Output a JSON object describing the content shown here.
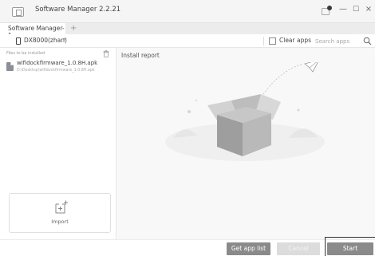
{
  "window": {
    "title": "Software Manager 2.2.21",
    "controls": {
      "minimize": "—",
      "maximize": "☐",
      "close": "×"
    }
  },
  "tabs": [
    {
      "label": "Software Manager-1"
    }
  ],
  "tab_add": "+",
  "device": {
    "name": "DX8000(zhan)",
    "caret": "▾"
  },
  "toolbar": {
    "clear_apps_label": "Clear apps",
    "clear_apps_checked": false,
    "search_placeholder": "Search apps"
  },
  "left_panel": {
    "section_label": "Files to be installed",
    "files": [
      {
        "name": "wifidockfirmware_1.0.8H.apk",
        "path": "D:\\Desktop\\wifidockfirmware_1.0.8H.apk"
      }
    ],
    "import_label": "Import"
  },
  "main_panel": {
    "title": "Install report"
  },
  "buttons": {
    "get_app_list": "Get app list",
    "cancel": "Cancel",
    "start": "Start"
  },
  "icons": [
    "app-icon",
    "notification-icon",
    "phone-icon",
    "search-icon",
    "trash-icon",
    "file-icon",
    "import-icon",
    "box-illustration"
  ],
  "colors": {
    "primary_button": "#8a8a8a",
    "disabled_button": "#dcdcdc",
    "main_panel_bg": "#f8f8f8"
  }
}
